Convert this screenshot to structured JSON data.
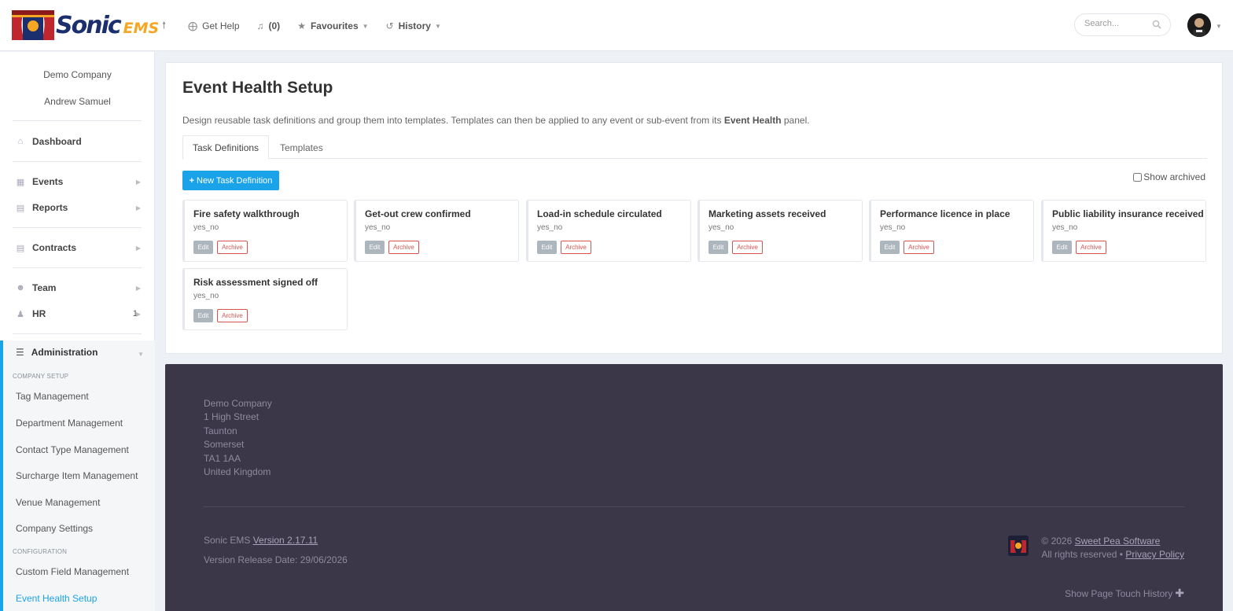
{
  "brand": {
    "name": "Sonic",
    "suffix": "EMS"
  },
  "topnav": {
    "help": "Get Help",
    "alerts": "(0)",
    "favourites": "Favourites",
    "history": "History"
  },
  "search": {
    "placeholder": "Search..."
  },
  "sidebar": {
    "company": "Demo Company",
    "user": "Andrew Samuel",
    "items": [
      {
        "label": "Dashboard"
      },
      {
        "label": "Events"
      },
      {
        "label": "Reports"
      },
      {
        "label": "Contracts"
      },
      {
        "label": "Team"
      },
      {
        "label": "HR",
        "badge": "1"
      }
    ],
    "admin": {
      "label": "Administration",
      "company_setup_label": "COMPANY SETUP",
      "company_setup": [
        "Tag Management",
        "Department Management",
        "Contact Type Management",
        "Surcharge Item Management",
        "Venue Management",
        "Company Settings"
      ],
      "configuration_label": "CONFIGURATION",
      "configuration": [
        "Custom Field Management",
        "Event Health Setup"
      ]
    }
  },
  "main": {
    "title": "Event Health Setup",
    "description_pre": "Design reusable task definitions and group them into templates. Templates can then be applied to any event or sub-event from its ",
    "description_bold": "Event Health",
    "description_post": " panel.",
    "tabs": [
      {
        "label": "Task Definitions",
        "active": true
      },
      {
        "label": "Templates",
        "active": false
      }
    ],
    "new_button": "New Task Definition",
    "show_archived": "Show archived",
    "edit_label": "Edit",
    "archive_label": "Archive",
    "tasks": [
      {
        "name": "Fire safety walkthrough",
        "type": "yes_no"
      },
      {
        "name": "Get-out crew confirmed",
        "type": "yes_no"
      },
      {
        "name": "Load-in schedule circulated",
        "type": "yes_no"
      },
      {
        "name": "Marketing assets received",
        "type": "yes_no"
      },
      {
        "name": "Performance licence in place",
        "type": "yes_no"
      },
      {
        "name": "Public liability insurance received",
        "type": "yes_no"
      },
      {
        "name": "Risk assessment signed off",
        "type": "yes_no"
      }
    ]
  },
  "footer": {
    "address": [
      "Demo Company",
      "1 High Street",
      "Taunton",
      "Somerset",
      "TA1 1AA",
      "United Kingdom"
    ],
    "product": "Sonic EMS",
    "version": "Version 2.17.11",
    "release": "Version Release Date: 29/06/2026",
    "copyright": "© 2026",
    "company_link": "Sweet Pea Software",
    "rights": "All rights reserved •",
    "privacy": "Privacy Policy",
    "touch_history": "Show Page Touch History"
  },
  "colors": {
    "accent": "#1aa3e8",
    "danger": "#d9534f",
    "footer_bg": "#3b3748"
  }
}
